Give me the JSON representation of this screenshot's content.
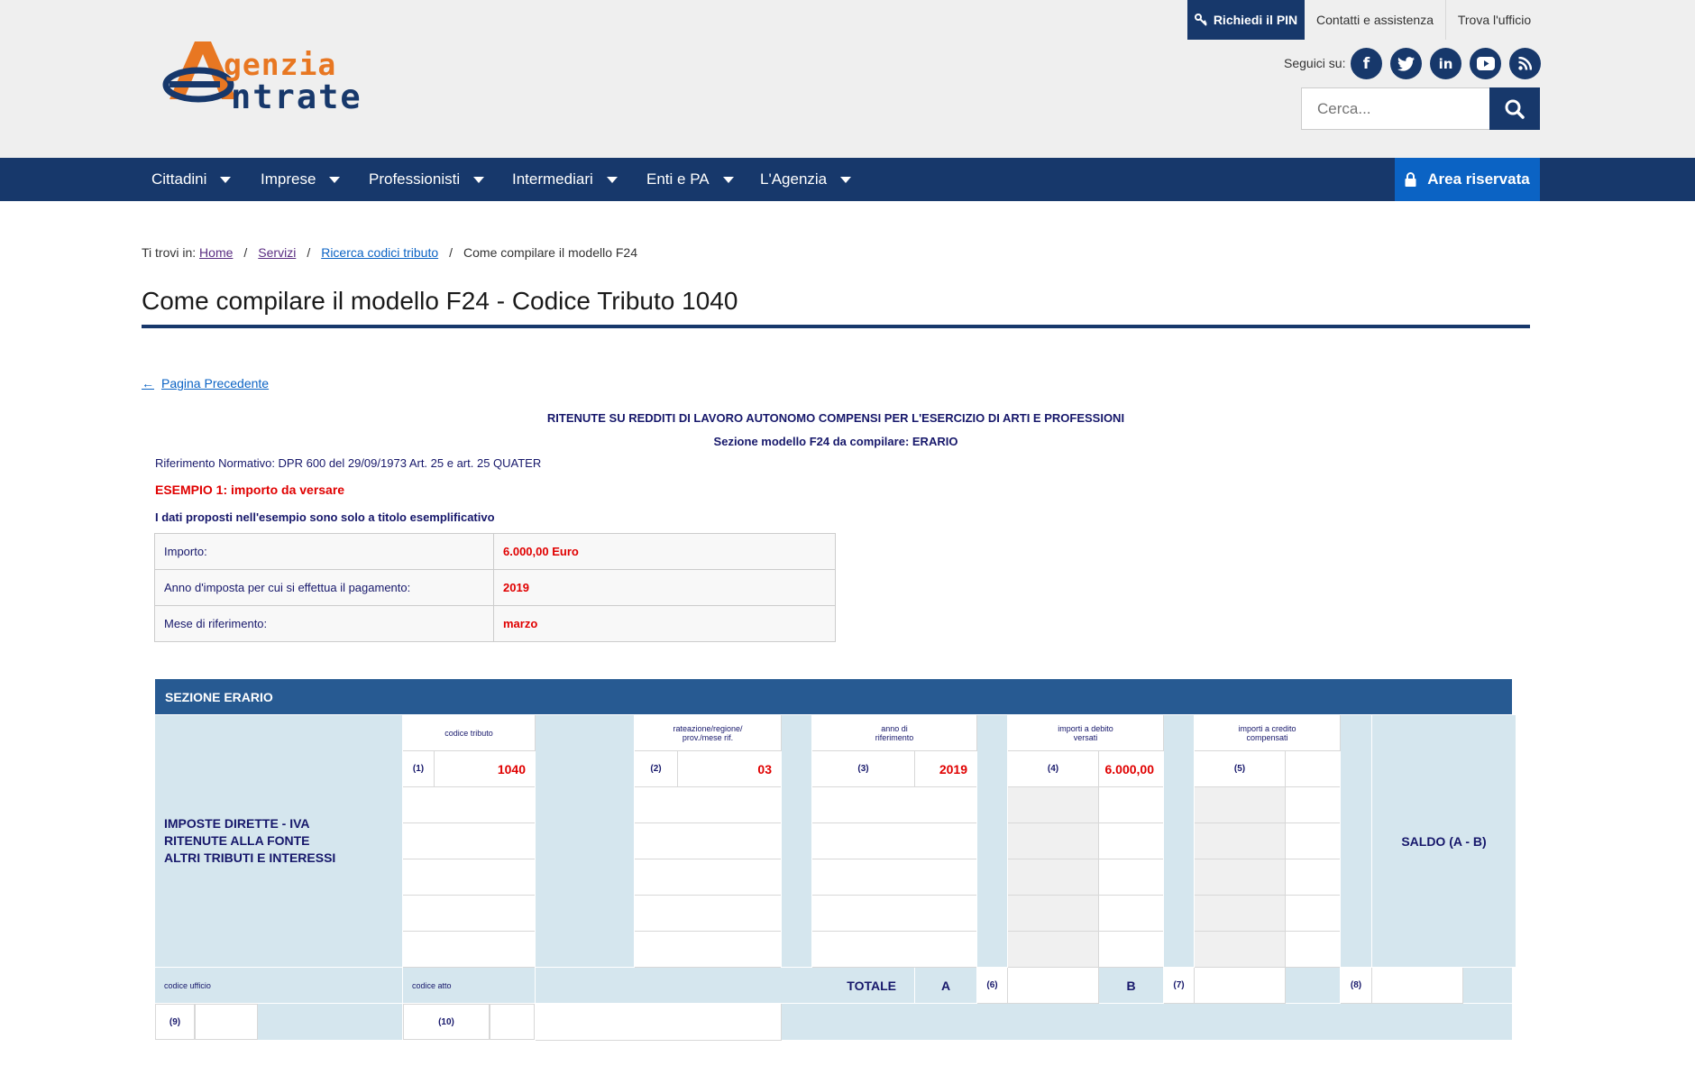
{
  "header": {
    "logo_line1": "genzia",
    "logo_line2": "ntrate",
    "pin_label": "Richiedi il PIN",
    "contact_label": "Contatti e assistenza",
    "office_label": "Trova l'ufficio",
    "follow_label": "Seguici su:",
    "social": [
      "facebook-icon",
      "twitter-icon",
      "linkedin-icon",
      "youtube-icon",
      "rss-icon"
    ],
    "search_placeholder": "Cerca..."
  },
  "nav": {
    "items": [
      "Cittadini",
      "Imprese",
      "Professionisti",
      "Intermediari",
      "Enti e PA",
      "L'Agenzia"
    ],
    "reserved_label": "Area riservata"
  },
  "breadcrumb": {
    "prefix": "Ti trovi in:",
    "links": [
      "Home",
      "Servizi",
      "Ricerca codici tributo"
    ],
    "current": "Come compilare il modello F24"
  },
  "page": {
    "title": "Come compilare il modello F24 - Codice Tributo 1040",
    "back_label": "Pagina Precedente",
    "heading1": "RITENUTE SU REDDITI DI LAVORO AUTONOMO COMPENSI PER L'ESERCIZIO DI ARTI E PROFESSIONI",
    "heading2": "Sezione modello F24 da compilare: ERARIO",
    "rif": "Riferimento Normativo: DPR  600 del 29/09/1973 Art. 25 e art. 25 QUATER",
    "example": "ESEMPIO 1: importo da versare",
    "note": "I dati proposti nell'esempio sono solo a titolo esemplificativo"
  },
  "info": [
    {
      "label": "Importo:",
      "value": "6.000,00 Euro"
    },
    {
      "label": "Anno d'imposta per cui si effettua il pagamento:",
      "value": "2019"
    },
    {
      "label": "Mese di riferimento:",
      "value": "marzo"
    }
  ],
  "f24": {
    "section_title": "SEZIONE ERARIO",
    "row_label_1": "IMPOSTE DIRETTE - IVA",
    "row_label_2": "RITENUTE ALLA FONTE",
    "row_label_3": "ALTRI TRIBUTI E INTERESSI",
    "col_codice": "codice tributo",
    "col_rateazione_1": "rateazione/regione/",
    "col_rateazione_2": "prov./mese rif.",
    "col_anno_1": "anno di",
    "col_anno_2": "riferimento",
    "col_debito_1": "importi a debito",
    "col_debito_2": "versati",
    "col_credito_1": "importi a credito",
    "col_credito_2": "compensati",
    "n1": "(1)",
    "n2": "(2)",
    "n3": "(3)",
    "n4": "(4)",
    "n5": "(5)",
    "n6": "(6)",
    "n7": "(7)",
    "n8": "(8)",
    "n9": "(9)",
    "n10": "(10)",
    "codice_tributo": "1040",
    "rateazione": "03",
    "anno": "2019",
    "importo_debito": "6.000,00",
    "saldo": "SALDO (A - B)",
    "totale": "TOTALE",
    "a": "A",
    "b": "B",
    "codice_ufficio": "codice ufficio",
    "codice_atto": "codice atto"
  }
}
